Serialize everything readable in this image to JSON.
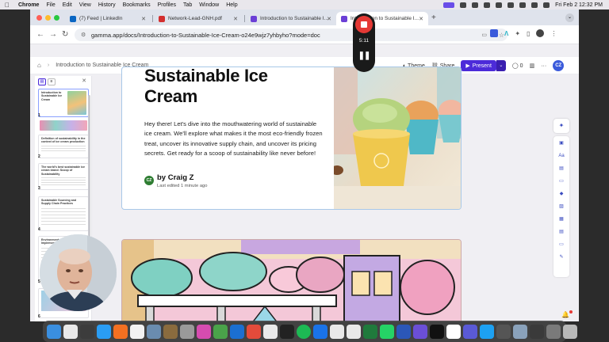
{
  "menubar": {
    "app": "Chrome",
    "items": [
      "File",
      "Edit",
      "View",
      "History",
      "Bookmarks",
      "Profiles",
      "Tab",
      "Window",
      "Help"
    ],
    "datetime": "Fri Feb 2  12:32 PM"
  },
  "tabs": [
    {
      "label": "(7) Feed | LinkedIn",
      "color": "#0a66c2"
    },
    {
      "label": "Network-Lead-GNH.pdf",
      "color": "#d32f2f"
    },
    {
      "label": "Introduction to Sustainable I...",
      "color": "#6b3fd6"
    },
    {
      "label": "Introduction to Sustainable I...",
      "color": "#6b3fd6"
    }
  ],
  "address": {
    "url": "gamma.app/docs/Introduction-to-Sustainable-Ice-Cream-o24e9wjz7yhbyho?mode=doc"
  },
  "recorder": {
    "time": "5:11"
  },
  "app_header": {
    "breadcrumb": "Introduction to Sustainable Ice Cream",
    "theme_label": "Theme",
    "share_label": "Share",
    "present_label": "Present",
    "comments_count": "0",
    "user_initials": "CZ"
  },
  "card": {
    "title_line1": "Sustainable Ice",
    "title_line2": "Cream",
    "body": "Hey there! Let's dive into the mouthwatering world of sustainable ice cream. We'll explore what makes it the most eco-friendly frozen treat, uncover its innovative supply chain, and uncover its pricing secrets. Get ready for a scoop of sustainability like never before!",
    "author_initials": "CZ",
    "author_name": "by Craig Z",
    "edited": "Last edited 1 minute ago"
  },
  "outline": [
    {
      "num": "1",
      "text": "Introduction to Sustainable Ice Cream"
    },
    {
      "num": "2",
      "text": "Definition of sustainability in the context of ice cream production"
    },
    {
      "num": "3",
      "text": "The world's best sustainable ice cream brand: Scoop of Sustainability"
    },
    {
      "num": "4",
      "text": "Sustainable Sourcing and Supply Chain Practices"
    },
    {
      "num": "5",
      "text": "Environmental Initiatives Implemented by Scoop"
    },
    {
      "num": "6",
      "text": ""
    }
  ]
}
